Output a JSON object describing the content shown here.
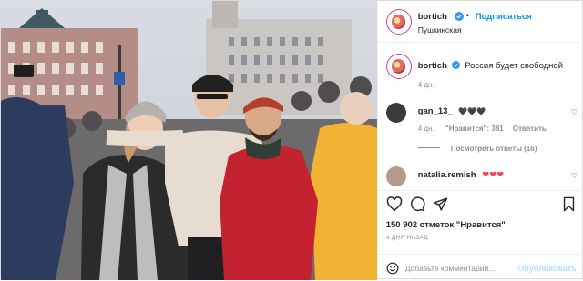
{
  "post": {
    "author": "bortich",
    "follow_label": "Подписаться",
    "location": "Пушкинская",
    "caption": "Россия будет свободной",
    "caption_age": "4 дн."
  },
  "comments": [
    {
      "user": "gan_13_",
      "text": "🖤🖤🖤",
      "age": "4 дн.",
      "likes": "\"Нравится\": 381",
      "reply_label": "Ответить",
      "view_replies": "Посмотреть ответы (16)"
    },
    {
      "user": "natalia.remish",
      "text": "❤❤❤"
    }
  ],
  "actions": {
    "likes_count": "150 902 отметок \"Нравится\"",
    "time_ago": "4 ДНЯ НАЗАД",
    "comment_placeholder": "Добавьте комментарий...",
    "publish_label": "Опубликовать"
  },
  "colors": {
    "accent": "#0095f6",
    "publish_disabled": "#b2dffc",
    "heart": "#ed4956"
  }
}
